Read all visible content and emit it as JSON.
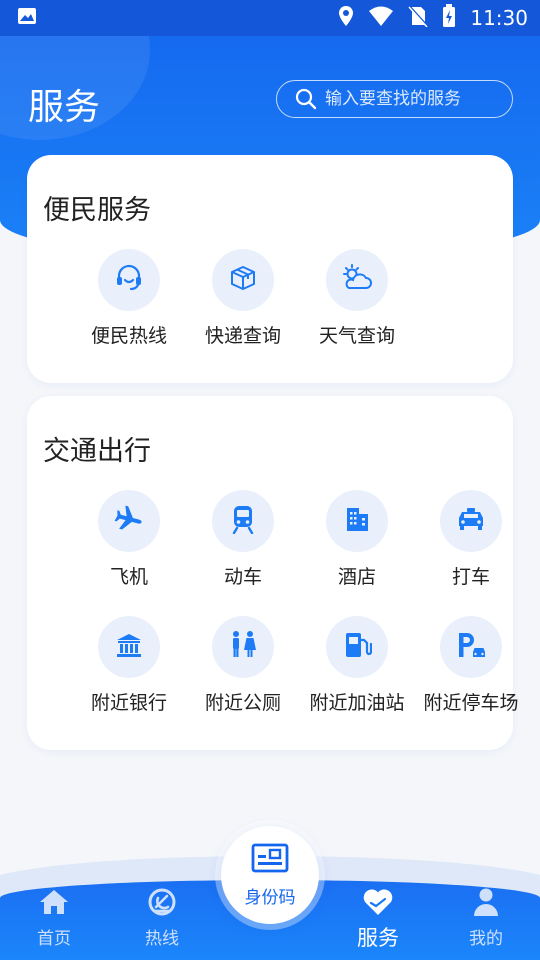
{
  "status_bar": {
    "time": "11:30",
    "icons": [
      "gallery-icon",
      "location-icon",
      "wifi-icon",
      "no-sim-icon",
      "battery-icon"
    ]
  },
  "header": {
    "title": "服务",
    "search": {
      "placeholder": "输入要查找的服务",
      "value": "",
      "icon": "search-icon"
    }
  },
  "sections": [
    {
      "title": "便民服务",
      "items": [
        {
          "label": "便民热线",
          "icon": "headset-icon"
        },
        {
          "label": "快递查询",
          "icon": "package-icon"
        },
        {
          "label": "天气查询",
          "icon": "weather-icon"
        }
      ]
    },
    {
      "title": "交通出行",
      "items": [
        {
          "label": "飞机",
          "icon": "airplane-icon"
        },
        {
          "label": "动车",
          "icon": "train-icon"
        },
        {
          "label": "酒店",
          "icon": "hotel-icon"
        },
        {
          "label": "打车",
          "icon": "taxi-icon"
        },
        {
          "label": "附近银行",
          "icon": "bank-icon"
        },
        {
          "label": "附近公厕",
          "icon": "restroom-icon"
        },
        {
          "label": "附近加油站",
          "icon": "gas-station-icon"
        },
        {
          "label": "附近停车场",
          "icon": "parking-icon"
        }
      ]
    }
  ],
  "bottom_nav": {
    "center": {
      "label": "身份码",
      "icon": "id-card-icon"
    },
    "tabs": [
      {
        "label": "首页",
        "icon": "home-icon",
        "active": false
      },
      {
        "label": "热线",
        "icon": "emblem-icon",
        "active": false
      },
      {
        "label": "服务",
        "icon": "heart-hand-icon",
        "active": true
      },
      {
        "label": "我的",
        "icon": "person-icon",
        "active": false
      }
    ]
  },
  "colors": {
    "primary": "#1466ee",
    "header_gradient_end": "#1b82f7",
    "icon_bg": "#eaf0fb",
    "page_bg": "#f4f6fa"
  }
}
